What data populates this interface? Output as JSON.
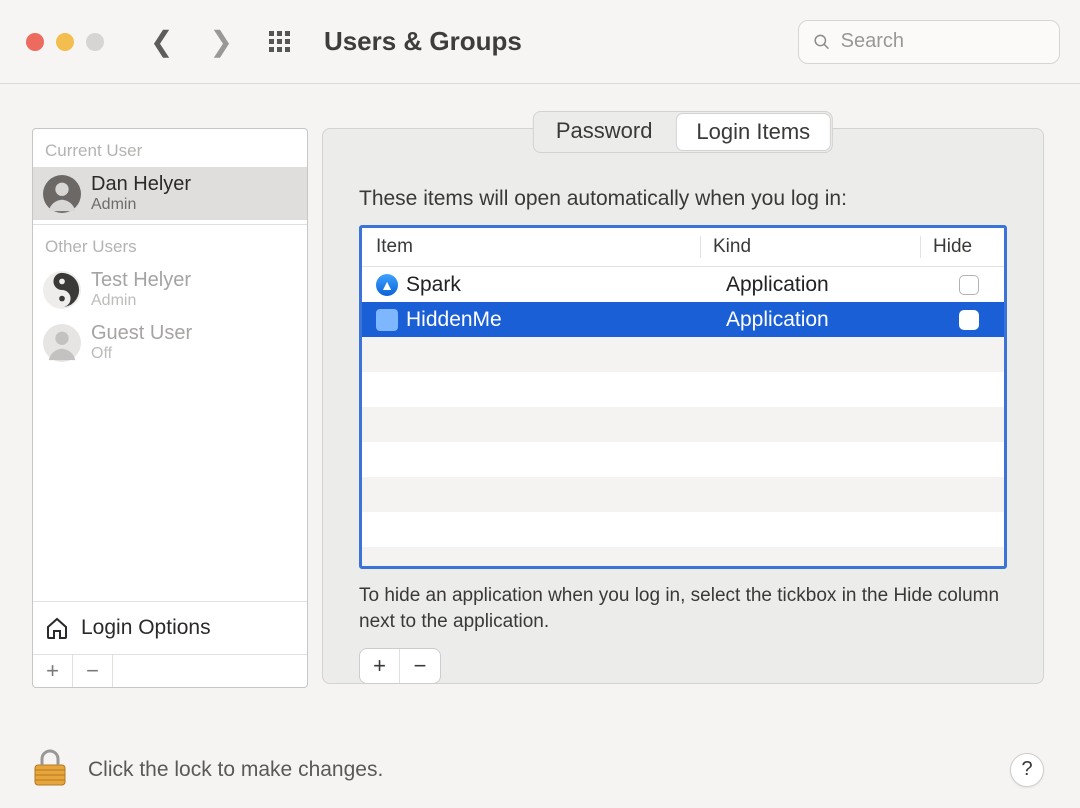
{
  "window": {
    "title": "Users & Groups",
    "search_placeholder": "Search"
  },
  "sidebar": {
    "current_user_label": "Current User",
    "other_users_label": "Other Users",
    "current_user": {
      "name": "Dan Helyer",
      "role": "Admin"
    },
    "other_users": [
      {
        "name": "Test Helyer",
        "role": "Admin"
      },
      {
        "name": "Guest User",
        "role": "Off"
      }
    ],
    "login_options_label": "Login Options"
  },
  "tabs": {
    "password": "Password",
    "login_items": "Login Items",
    "active": "login_items"
  },
  "login_items": {
    "description": "These items will open automatically when you log in:",
    "columns": {
      "item": "Item",
      "kind": "Kind",
      "hide": "Hide"
    },
    "rows": [
      {
        "name": "Spark",
        "kind": "Application",
        "hide": false,
        "selected": false
      },
      {
        "name": "HiddenMe",
        "kind": "Application",
        "hide": false,
        "selected": true
      }
    ],
    "hint": "To hide an application when you log in, select the tickbox in the Hide column next to the application."
  },
  "footer": {
    "lock_message": "Click the lock to make changes.",
    "help_label": "?"
  }
}
